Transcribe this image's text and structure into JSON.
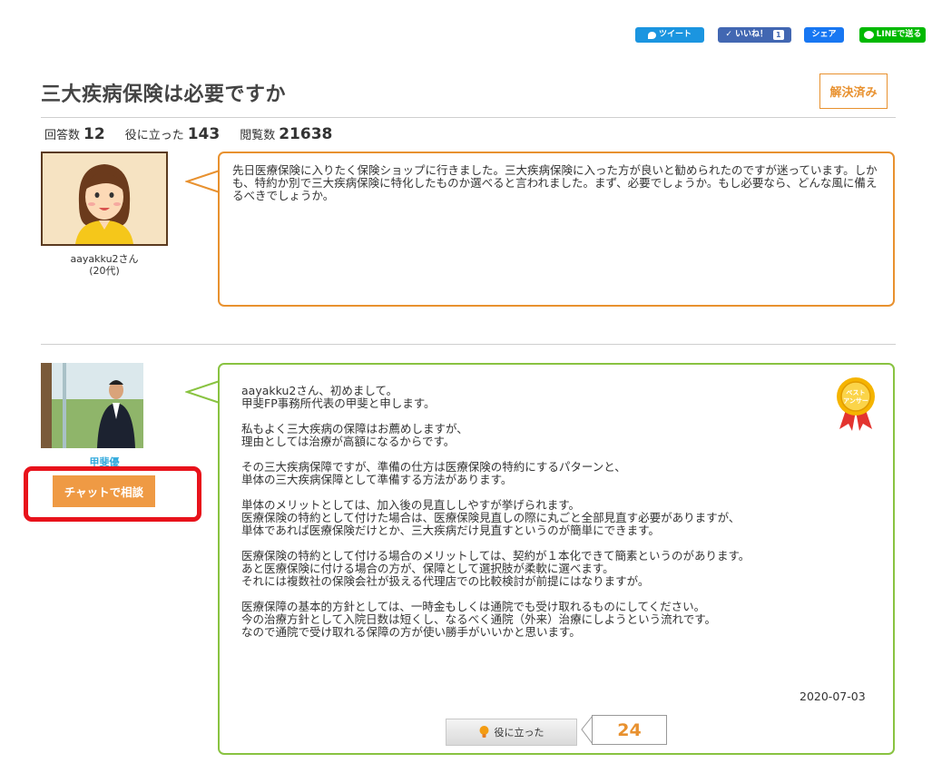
{
  "share": {
    "tweet_label": "ツイート",
    "like_label": "いいね！",
    "like_count": "1",
    "share_label": "シェア",
    "line_label": "LINEで送る"
  },
  "question": {
    "title": "三大疾病保険は必要ですか",
    "status": "解決済み",
    "stats": {
      "answers_label": "回答数",
      "answers": "12",
      "helpful_label": "役に立った",
      "helpful": "143",
      "views_label": "閲覧数",
      "views": "21638"
    },
    "user_name": "aayakku2さん",
    "user_age": "(20代)",
    "body": "先日医療保険に入りたく保険ショップに行きました。三大疾病保険に入った方が良いと勧められたのですが迷っています。しかも、特約か別で三大疾病保険に特化したものか選べると言われました。まず、必要でしょうか。もし必要なら、どんな風に備えるべきでしょうか。"
  },
  "answer": {
    "author": "甲斐優",
    "chat_button": "チャットで相談",
    "badge_text": "ベスト アンサー",
    "paragraphs": [
      "aayakku2さん、初めまして。\n甲斐FP事務所代表の甲斐と申します。",
      "私もよく三大疾病の保障はお薦めしますが、\n理由としては治療が高額になるからです。",
      "その三大疾病保障ですが、準備の仕方は医療保険の特約にするパターンと、\n単体の三大疾病保障として準備する方法があります。",
      "単体のメリットとしては、加入後の見直ししやすが挙げられます。\n医療保険の特約として付けた場合は、医療保険見直しの際に丸ごと全部見直す必要がありますが、\n単体であれば医療保険だけとか、三大疾病だけ見直すというのが簡単にできます。",
      "医療保険の特約として付ける場合のメリットしては、契約が１本化できて簡素というのがあります。\nあと医療保険に付ける場合の方が、保障として選択肢が柔軟に選べます。\nそれには複数社の保険会社が扱える代理店での比較検討が前提にはなりますが。",
      "医療保障の基本的方針としては、一時金もしくは通院でも受け取れるものにしてください。\n今の治療方針として入院日数は短くし、なるべく通院（外来）治療にしようという流れです。\nなので通院で受け取れる保障の方が使い勝手がいいかと思います。"
    ],
    "date": "2020-07-03",
    "useful_label": "役に立った",
    "useful_count": "24"
  },
  "colors": {
    "orange": "#e8912f",
    "green": "#89c341",
    "highlight_red": "#e8121b",
    "name_blue": "#33aadd"
  }
}
